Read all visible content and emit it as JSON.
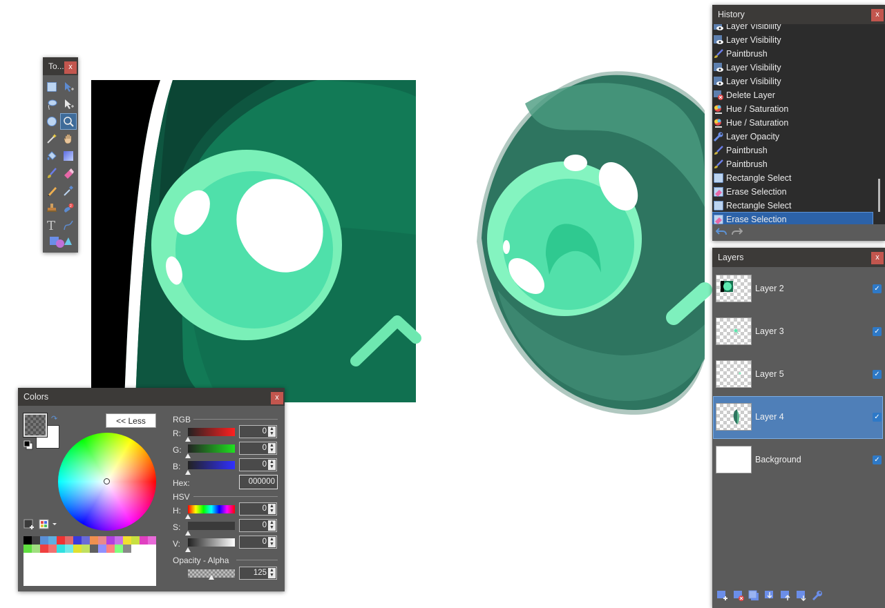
{
  "toolbox": {
    "title": "To...",
    "close_label": "x"
  },
  "history": {
    "title": "History",
    "close_label": "x",
    "items": [
      {
        "label": "Layer Visibility",
        "icon": "eye-icon"
      },
      {
        "label": "Layer Visibility",
        "icon": "eye-icon"
      },
      {
        "label": "Paintbrush",
        "icon": "paintbrush-icon"
      },
      {
        "label": "Layer Visibility",
        "icon": "eye-icon"
      },
      {
        "label": "Layer Visibility",
        "icon": "eye-icon"
      },
      {
        "label": "Delete Layer",
        "icon": "delete-layer-icon"
      },
      {
        "label": "Hue / Saturation",
        "icon": "hue-icon"
      },
      {
        "label": "Hue / Saturation",
        "icon": "hue-icon"
      },
      {
        "label": "Layer Opacity",
        "icon": "wrench-icon"
      },
      {
        "label": "Paintbrush",
        "icon": "paintbrush-icon"
      },
      {
        "label": "Paintbrush",
        "icon": "paintbrush-icon"
      },
      {
        "label": "Rectangle Select",
        "icon": "rect-select-icon"
      },
      {
        "label": "Erase Selection",
        "icon": "erase-selection-icon"
      },
      {
        "label": "Rectangle Select",
        "icon": "rect-select-icon"
      },
      {
        "label": "Erase Selection",
        "icon": "erase-selection-icon"
      }
    ],
    "selected_index": 14
  },
  "layers": {
    "title": "Layers",
    "close_label": "x",
    "items": [
      {
        "name": "Layer 2",
        "visible": true
      },
      {
        "name": "Layer 3",
        "visible": true
      },
      {
        "name": "Layer 5",
        "visible": true
      },
      {
        "name": "Layer 4",
        "visible": true
      },
      {
        "name": "Background",
        "visible": true
      }
    ],
    "selected_index": 3
  },
  "colors": {
    "title": "Colors",
    "close_label": "x",
    "less_button": "<< Less",
    "rgb_label": "RGB",
    "r_label": "R:",
    "g_label": "G:",
    "b_label": "B:",
    "hex_label": "Hex:",
    "hsv_label": "HSV",
    "h_label": "H:",
    "s_label": "S:",
    "v_label": "V:",
    "opacity_label": "Opacity - Alpha",
    "r": "0",
    "g": "0",
    "b": "0",
    "hex": "000000",
    "h": "0",
    "s": "0",
    "v": "0",
    "alpha": "125"
  },
  "palette": [
    "#000000",
    "#404040",
    "#5a8fd6",
    "#5faee0",
    "#ee3333",
    "#e06a6a",
    "#3a3adc",
    "#6a6ad8",
    "#f09050",
    "#e88a8a",
    "#b040e0",
    "#c770e8",
    "#f0e030",
    "#c8e040",
    "#e040c0",
    "#e86ad8",
    "#60e040",
    "#a0e080",
    "#f04040",
    "#f07070",
    "#30e0e0",
    "#70e8e8",
    "#e0e030",
    "#c0e060",
    "#606060",
    "#9090ff",
    "#ff8080",
    "#80ff80",
    "#8a8a8a"
  ]
}
